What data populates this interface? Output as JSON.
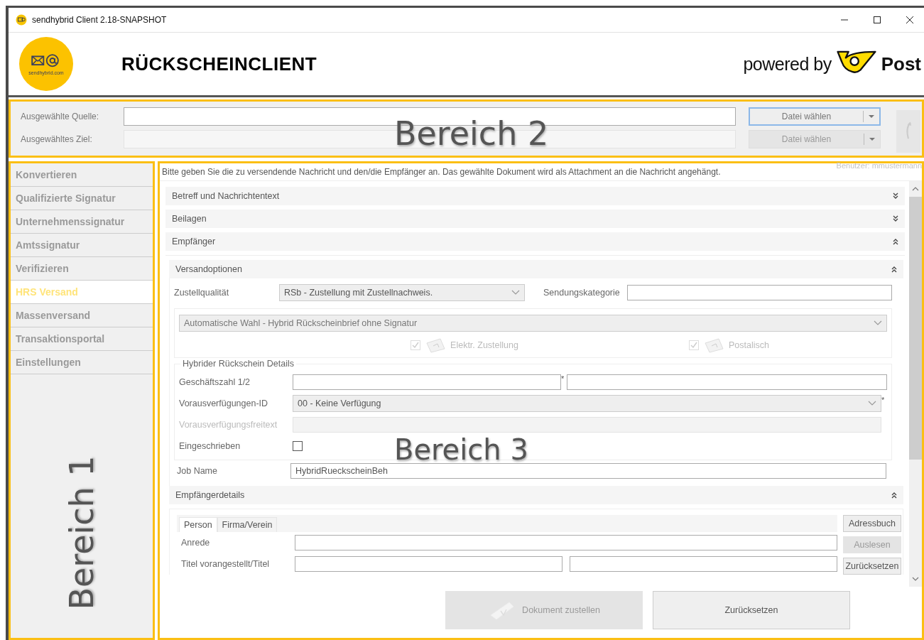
{
  "window": {
    "title": "sendhybrid Client 2.18-SNAPSHOT"
  },
  "header": {
    "logo_text": "sendhybrid.com",
    "title": "RÜCKSCHEINCLIENT",
    "powered_by": "powered by",
    "brand": "Post"
  },
  "file_bar": {
    "annotation": "Bereich 2",
    "rows": [
      {
        "label": "Ausgewählte Quelle:",
        "disabled": false,
        "button": "Datei wählen"
      },
      {
        "label": "Ausgewähltes Ziel:",
        "disabled": true,
        "button": "Datei wählen"
      }
    ]
  },
  "sidebar": {
    "annotation": "Bereich 1",
    "items": [
      {
        "label": "Konvertieren",
        "selected": false
      },
      {
        "label": "Qualifizierte Signatur",
        "selected": false
      },
      {
        "label": "Unternehmenssignatur",
        "selected": false
      },
      {
        "label": "Amtssignatur",
        "selected": false
      },
      {
        "label": "Verifizieren",
        "selected": false
      },
      {
        "label": "HRS Versand",
        "selected": true
      },
      {
        "label": "Massenversand",
        "selected": false
      },
      {
        "label": "Transaktionsportal",
        "selected": false
      },
      {
        "label": "Einstellungen",
        "selected": false
      }
    ]
  },
  "main": {
    "annotation": "Bereich 3",
    "intro": "Bitte geben Sie die zu versendende Nachricht und den/die Empfänger an. Das gewählte Dokument wird als Attachment an die Nachricht angehängt.",
    "user": "Benutzer: mmustermann",
    "sections": [
      {
        "title": "Betreff und Nachrichtentext",
        "expanded": false
      },
      {
        "title": "Beilagen",
        "expanded": false
      },
      {
        "title": "Empfänger",
        "expanded": true
      }
    ],
    "shipping_options": {
      "title": "Versandoptionen",
      "expanded": true,
      "delivery_quality": {
        "label": "Zustellqualität",
        "value": "RSb - Zustellung mit Zustellnachweis."
      },
      "category": {
        "label": "Sendungskategorie"
      },
      "auto_choice": {
        "value": "Automatische Wahl - Hybrid Rückscheinbrief ohne Signatur",
        "disabled": true
      },
      "channels": [
        {
          "label": "Elektr. Zustellung",
          "checked": true,
          "disabled": true
        },
        {
          "label": "Postalisch",
          "checked": true,
          "disabled": true
        }
      ],
      "hybrid_details": {
        "legend": "Hybrider Rückschein Details",
        "fields": [
          {
            "kind": "split",
            "label": "Geschäftszahl 1/2",
            "mark": "*"
          },
          {
            "kind": "select",
            "label": "Vorausverfügungen-ID",
            "value": "00 - Keine Verfügung",
            "mark": "*"
          },
          {
            "kind": "text",
            "label": "Vorausverfügungsfreitext",
            "disabled": true
          },
          {
            "kind": "checkbox",
            "label": "Eingeschrieben",
            "checked": false
          }
        ]
      },
      "job_name": {
        "label": "Job Name",
        "value": "HybridRueckscheinBeh"
      }
    },
    "recipient_details": {
      "title": "Empfängerdetails",
      "expanded": true,
      "tabs": [
        {
          "label": "Person",
          "selected": true
        },
        {
          "label": "Firma/Verein",
          "selected": false
        }
      ],
      "fields": [
        {
          "kind": "text",
          "label": "Anrede"
        },
        {
          "kind": "pair",
          "label": "Titel vorangestellt/Titel"
        }
      ],
      "buttons": [
        {
          "label": "Adressbuch",
          "disabled": false
        },
        {
          "label": "Auslesen",
          "disabled": true
        },
        {
          "label": "Zurücksetzen",
          "disabled": false
        }
      ]
    },
    "footer_buttons": [
      {
        "label": "Dokument zustellen",
        "disabled": true,
        "kind": "send"
      },
      {
        "label": "Zurücksetzen",
        "disabled": false,
        "kind": "plain"
      }
    ]
  }
}
